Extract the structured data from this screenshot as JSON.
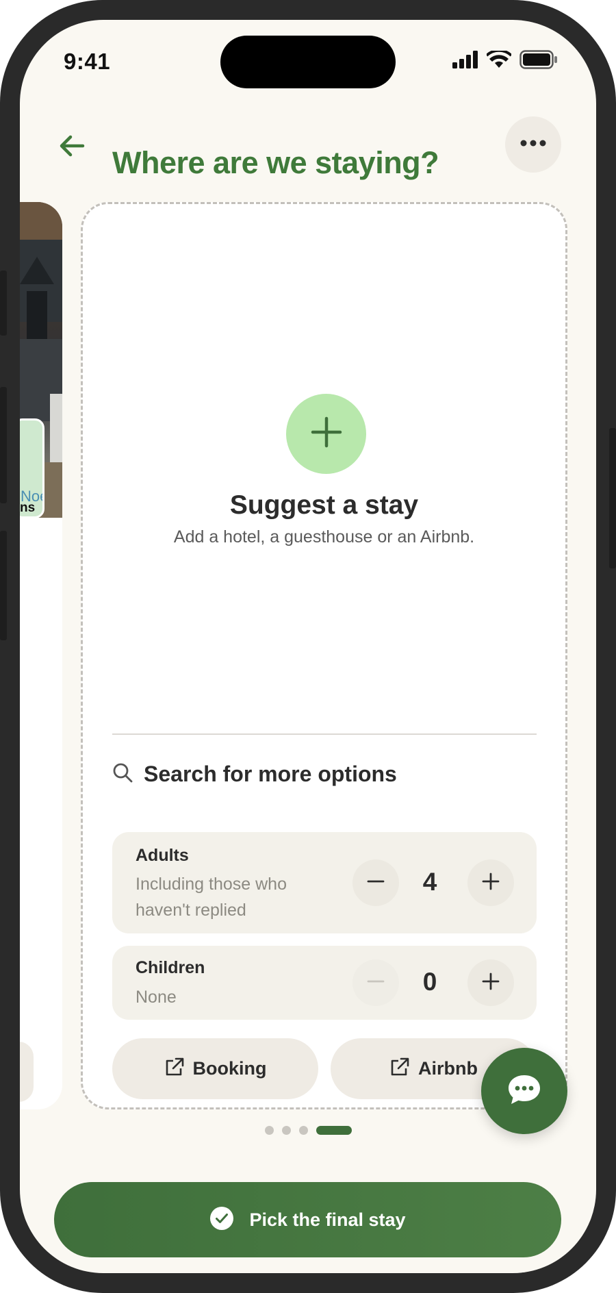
{
  "status_bar": {
    "time": "9:41",
    "icons": [
      "signal-icon",
      "wifi-icon",
      "battery-icon"
    ]
  },
  "header": {
    "title": "Where are we staying?",
    "back_icon": "arrow-left-icon",
    "more_icon": "ellipsis-icon"
  },
  "left_card": {
    "partial_text_1": "Noe",
    "partial_text_2": "ns"
  },
  "suggest": {
    "icon": "plus-icon",
    "title": "Suggest a stay",
    "subtitle": "Add a hotel, a guesthouse or an Airbnb."
  },
  "search": {
    "icon": "search-icon",
    "label": "Search for more options"
  },
  "guests": {
    "adults": {
      "label": "Adults",
      "sublabel": "Including those who haven't replied",
      "count": "4"
    },
    "children": {
      "label": "Children",
      "sublabel": "None",
      "count": "0"
    }
  },
  "links": {
    "booking": "Booking",
    "airbnb": "Airbnb"
  },
  "pager": {
    "total": 4,
    "active_index": 3
  },
  "cta": {
    "label": "Pick the final stay"
  },
  "colors": {
    "brand_green": "#3f6f3b",
    "title_green": "#3f7a3a",
    "accent_light_green": "#b8e8ac",
    "background": "#faf8f2"
  }
}
